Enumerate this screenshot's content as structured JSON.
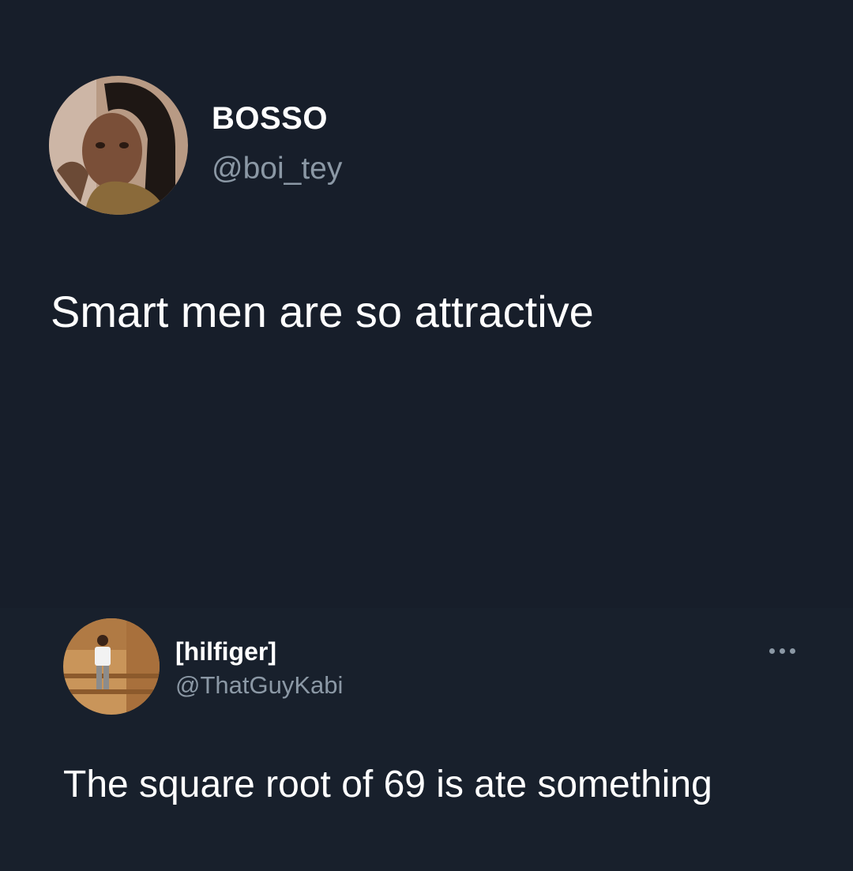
{
  "main_tweet": {
    "display_name": "BOSSO",
    "handle": "@boi_tey",
    "text": "Smart men are so attractive"
  },
  "reply_tweet": {
    "display_name": "[hilfiger]",
    "handle": "@ThatGuyKabi",
    "text": "The square root of 69 is ate something",
    "more_icon": "more-horizontal-icon"
  },
  "colors": {
    "background": "#171e2a",
    "primary_text": "#ffffff",
    "secondary_text": "#8b98a5"
  }
}
